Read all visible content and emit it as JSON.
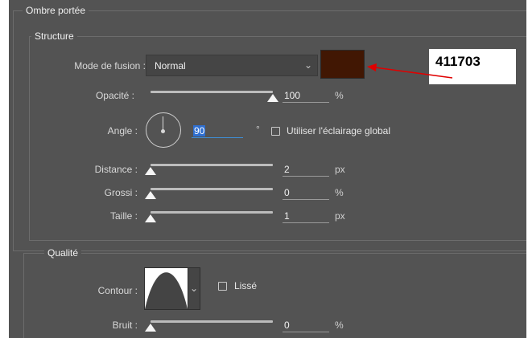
{
  "sections": {
    "drop_shadow": "Ombre portée",
    "structure": "Structure",
    "quality": "Qualité"
  },
  "blend": {
    "label": "Mode de fusion :",
    "value": "Normal",
    "chevron_icon": "chevron-down-icon",
    "shadow_color": "#411703"
  },
  "opacity": {
    "label": "Opacité :",
    "value": "100",
    "unit": "%",
    "fraction": 1.0
  },
  "angle": {
    "label": "Angle :",
    "value": "90",
    "unit": "°",
    "dial_icon": "angle-dial-icon",
    "global_light_label": "Utiliser l'éclairage global",
    "global_light_checked": false
  },
  "distance": {
    "label": "Distance :",
    "value": "2",
    "unit": "px",
    "fraction": 0.0
  },
  "spread": {
    "label": "Grossi :",
    "value": "0",
    "unit": "%",
    "fraction": 0.0
  },
  "size": {
    "label": "Taille :",
    "value": "1",
    "unit": "px",
    "fraction": 0.0
  },
  "contour": {
    "label": "Contour :",
    "preview_icon": "contour-curve-icon",
    "antialias_label": "Lissé",
    "antialias_checked": false
  },
  "noise": {
    "label": "Bruit :",
    "value": "0",
    "unit": "%",
    "fraction": 0.0
  },
  "annotation": {
    "text": "411703",
    "arrow_color": "#e00000"
  },
  "colors": {
    "panel_bg": "#535353",
    "field_bg": "#454545",
    "border": "#6c6c6c"
  }
}
